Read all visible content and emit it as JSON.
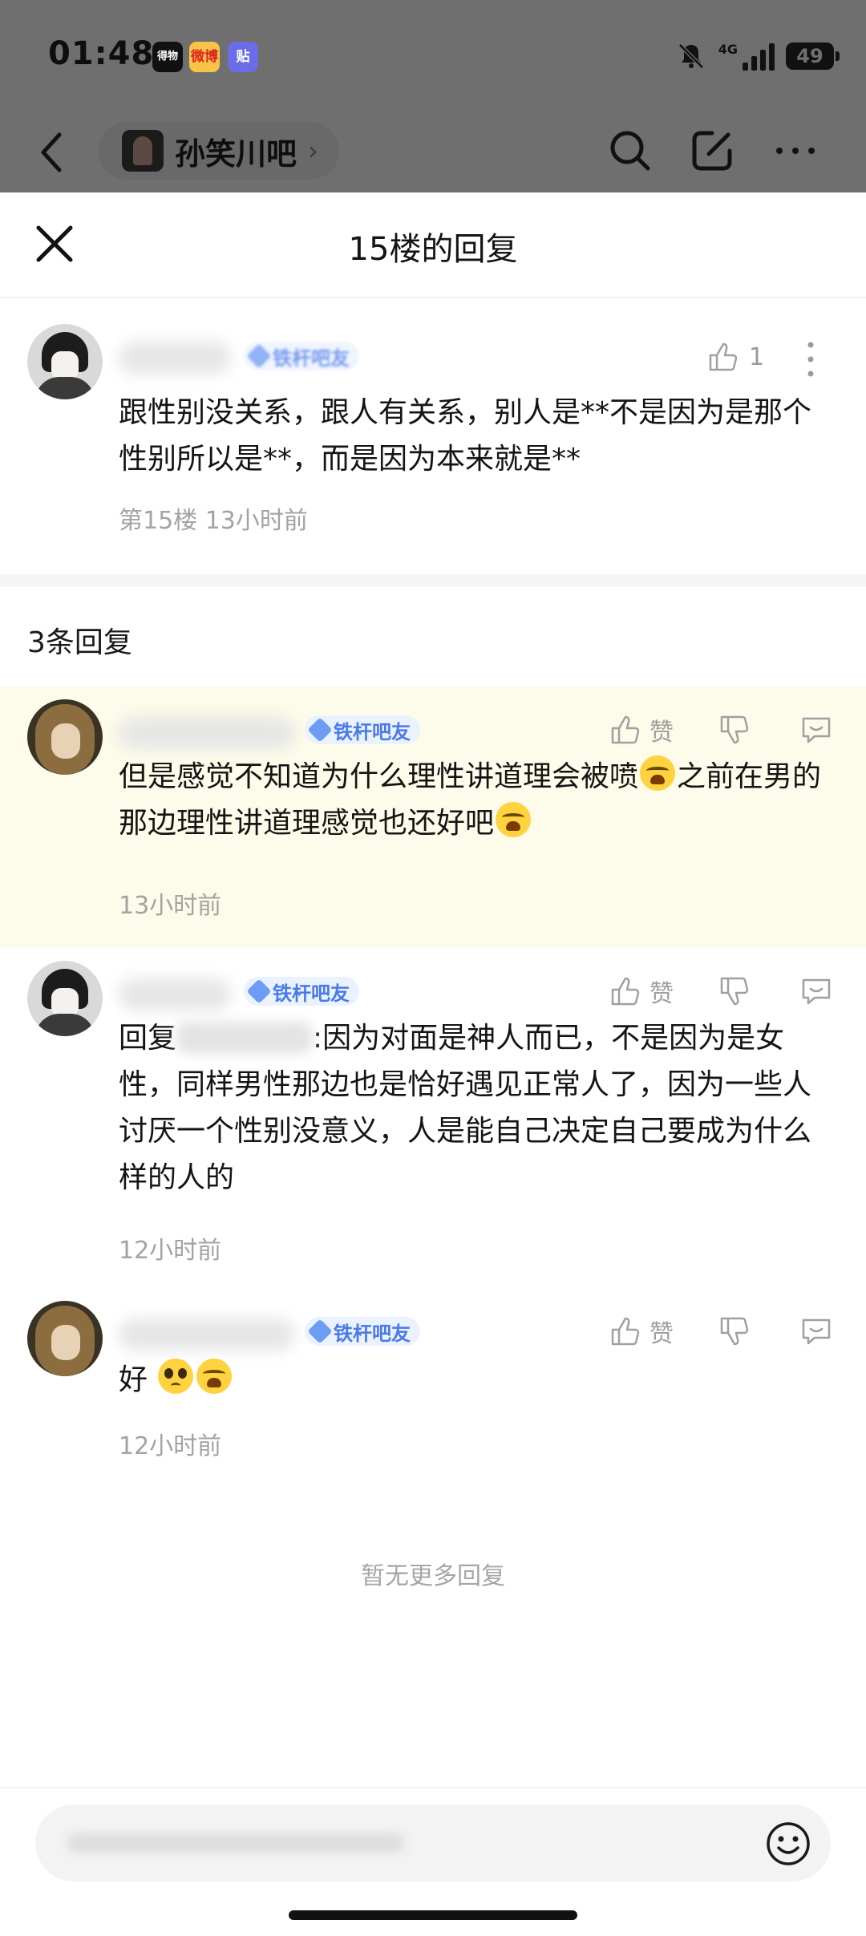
{
  "status": {
    "time": "01:48",
    "apps": [
      "得物",
      "微博",
      "贴"
    ],
    "network": "4G",
    "battery": "49"
  },
  "nav": {
    "forum_name": "孙笑川吧"
  },
  "sheet": {
    "title": "15楼的回复"
  },
  "main_post": {
    "badge": "铁杆吧友",
    "likes": "1",
    "text": "跟性别没关系，跟人有关系，别人是**不是因为是那个性别所以是**，而是因为本来就是**",
    "meta": "第15楼 13小时前"
  },
  "reply_count": "3条回复",
  "action_labels": {
    "like": "赞"
  },
  "replies": [
    {
      "badge": "铁杆吧友",
      "text_part1": "但是感觉不知道为什么理性讲道理会被喷",
      "text_part2": "之前在男的那边理性讲道理感觉也还好吧",
      "time": "13小时前"
    },
    {
      "badge": "铁杆吧友",
      "reply_prefix": "回复",
      "text": ":因为对面是神人而已，不是因为是女性，同样男性那边也是恰好遇见正常人了，因为一些人讨厌一个性别没意义，人是能自己决定自己要成为什么样的人的",
      "time": "12小时前"
    },
    {
      "badge": "铁杆吧友",
      "text": "好",
      "time": "12小时前"
    }
  ],
  "no_more": "暂无更多回复",
  "icons": [
    "back-icon",
    "search-icon",
    "edit-icon",
    "more-icon",
    "close-icon",
    "thumb-up-icon",
    "thumb-down-icon",
    "comment-icon",
    "smile-icon",
    "cry-emoji",
    "pleading-emoji"
  ],
  "colors": {
    "badge_text": "#4a79e8",
    "highlight_bg": "#fdfbe9",
    "meta_gray": "#a3a3a3"
  }
}
